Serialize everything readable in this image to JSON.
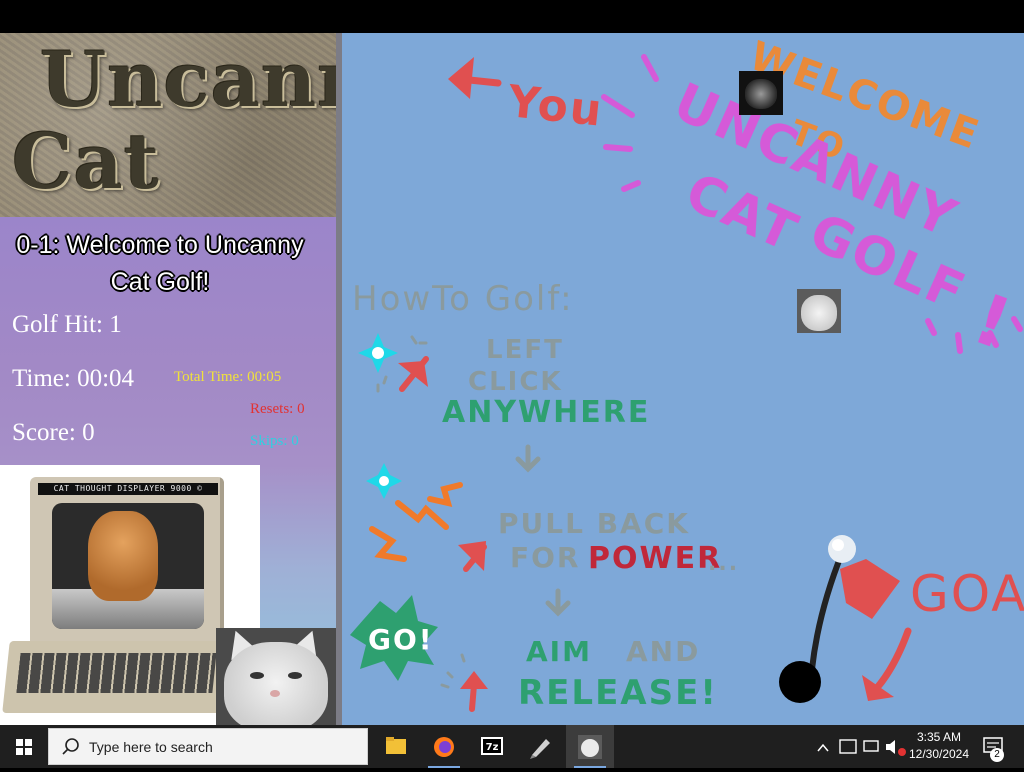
{
  "colors": {
    "playfield": "#7ea8d8",
    "sidebar": "#9a86c9",
    "hit_text": "#ffffff",
    "total_time": "#f0e23a",
    "resets": "#e23232",
    "skips": "#2fd0e0",
    "taskbar": "#1f1f1f"
  },
  "logo": {
    "line1": "Uncanny",
    "line2": "Cat Golf"
  },
  "level": {
    "title": "0-1: Welcome to Uncanny Cat Golf!"
  },
  "stats": {
    "golf_hit": "Golf Hit: 1",
    "time": "Time: 00:04",
    "score": "Score: 0",
    "total_time": "Total Time: 00:05",
    "resets": "Resets: 0",
    "skips": "Skips: 0"
  },
  "monitor_label": "CAT THOUGHT DISPLAYER 9000 ©",
  "playfield": {
    "you": "You",
    "welcome": "WELCOME",
    "to": "TO",
    "uncanny": "UNCANNY",
    "cat": "CAT",
    "golf": "GOLF",
    "exclaim": "!",
    "how_to": "HowTo Golf:",
    "left": "LEFT",
    "click": "CLICK",
    "anywhere": "ANYWHERE",
    "pull_back": "PULL BACK",
    "for": "FOR",
    "power": "POWER",
    "ellipsis": "...",
    "aim": "AIM",
    "and": "AND",
    "release": "RELEASE!",
    "goal": "GOAL",
    "go": "GO!"
  },
  "taskbar": {
    "search_placeholder": "Type here to search",
    "time": "3:35 AM",
    "date": "12/30/2024",
    "notification_count": "2",
    "icons": [
      "windows-start-icon",
      "search-icon",
      "file-explorer-icon",
      "firefox-icon",
      "7zip-icon",
      "pen-tool-icon",
      "cat-game-icon"
    ]
  }
}
